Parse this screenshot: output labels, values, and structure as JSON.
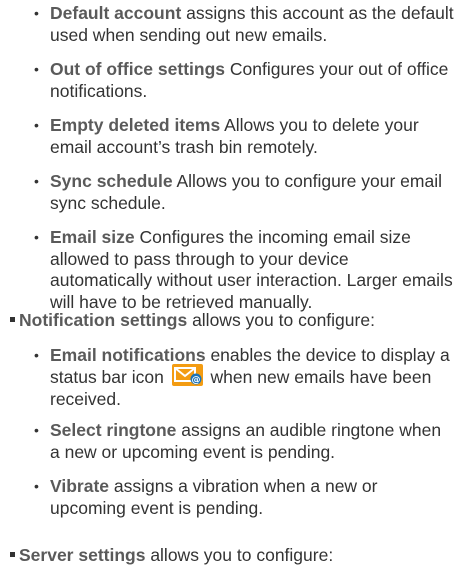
{
  "settings_list_1": [
    {
      "term": "Default account",
      "desc": " assigns this account as the default used when sending out new emails."
    },
    {
      "term": "Out of office settings",
      "desc": " Configures your out of office notifications."
    },
    {
      "term": "Empty deleted items",
      "desc": " Allows you to delete your email account’s trash bin remotely."
    },
    {
      "term": "Sync schedule",
      "desc": " Allows you to configure your email sync schedule."
    },
    {
      "term": "Email size",
      "desc": " Configures the incoming email size allowed to pass through to your device automatically without user interaction. Larger emails will have to be retrieved manually."
    }
  ],
  "notification_settings": {
    "term": "Notification settings",
    "desc": " allows you to configure:",
    "items": [
      {
        "term": "Email notifications",
        "desc_before": " enables the device to display a status bar icon ",
        "desc_after": " when new emails have been received."
      },
      {
        "term": "Select ringtone",
        "desc": " assigns an audible ringtone when a new or upcoming event is pending."
      },
      {
        "term": "Vibrate",
        "desc": " assigns a vibration when a new or upcoming event is pending."
      }
    ]
  },
  "server_settings": {
    "term": "Server settings",
    "desc": " allows you to configure:"
  },
  "icons": {
    "status_bar_icon": "new-email-status-icon",
    "icon_color": "#f39c12"
  }
}
